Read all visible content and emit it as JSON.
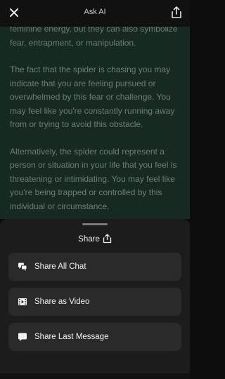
{
  "header": {
    "title": "Ask AI",
    "close_icon": "close-icon",
    "share_icon": "share-icon"
  },
  "chat": {
    "paragraphs": [
      "feminine energy, but they can also symbolize fear, entrapment, or manipulation.",
      "The fact that the spider is chasing you may indicate that you are feeling pursued or overwhelmed by this fear or challenge. You may feel like you're constantly running away from or trying to avoid this obstacle.",
      "Alternatively, the spider could represent a person or situation in your life that you feel is threatening or intimidating. You may feel like you're being trapped or controlled by this individual or circumstance."
    ]
  },
  "share_sheet": {
    "title": "Share",
    "options": [
      {
        "label": "Share All Chat",
        "icon": "chat-bubbles-icon"
      },
      {
        "label": "Share as Video",
        "icon": "video-icon"
      },
      {
        "label": "Share Last Message",
        "icon": "message-icon"
      }
    ]
  },
  "colors": {
    "background": "#0c0c0c",
    "chat_background": "#162a22",
    "sheet_background": "#1c1c1c",
    "button_background": "#2a2a2a",
    "text_primary": "#f2f2f2",
    "text_muted": "#6f7d76"
  }
}
